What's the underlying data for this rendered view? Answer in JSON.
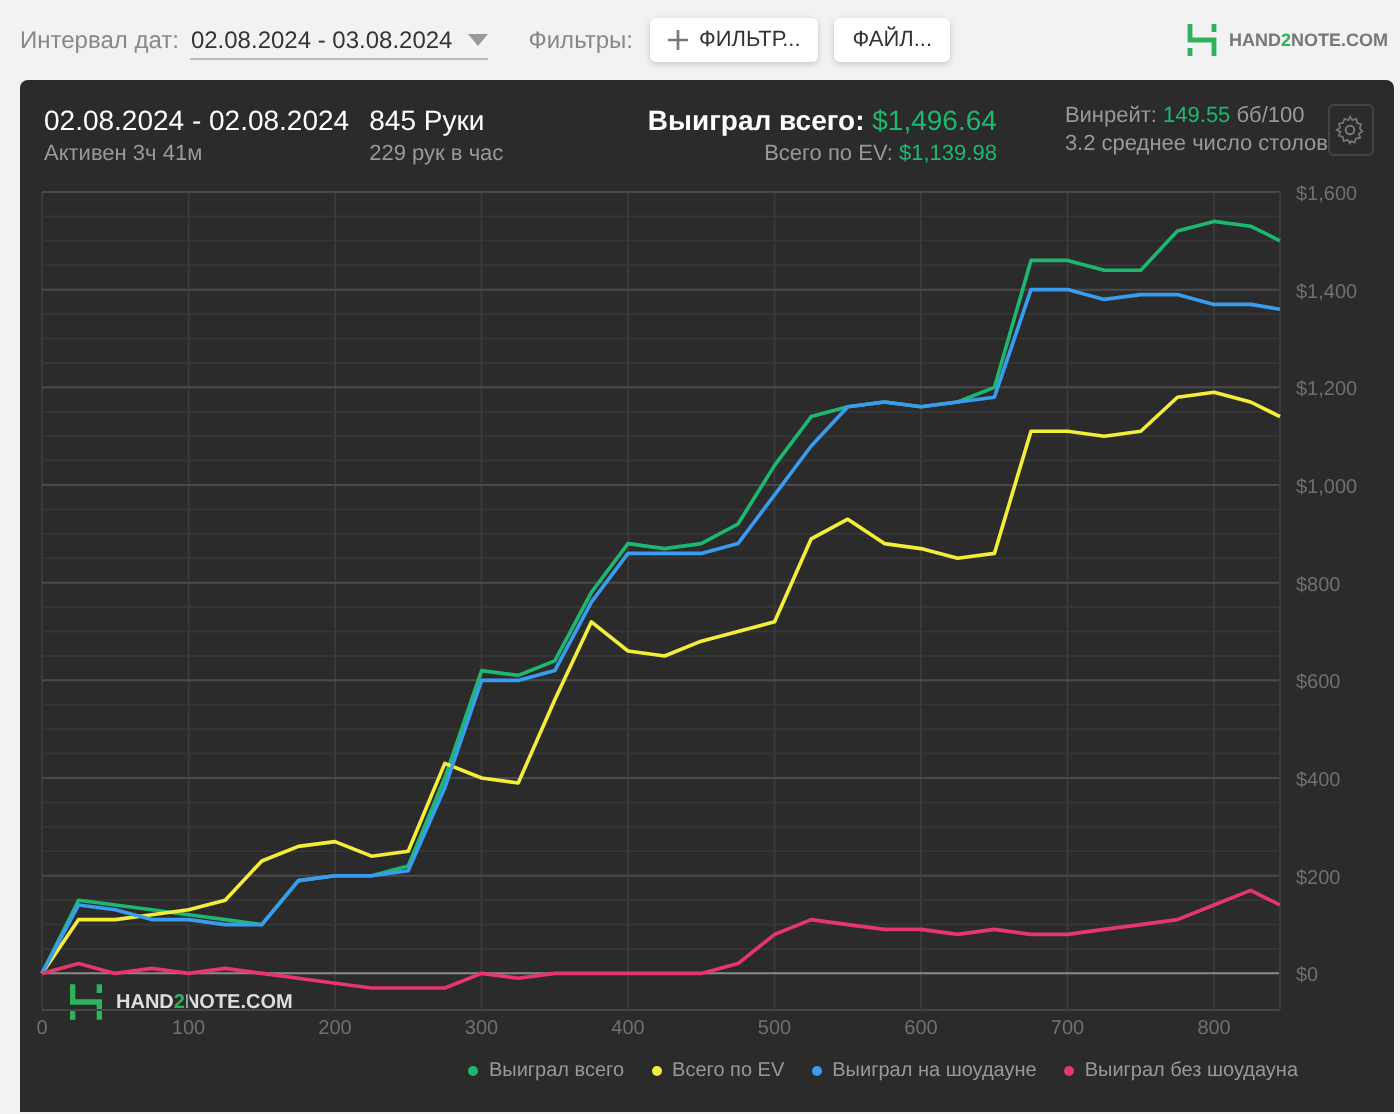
{
  "toolbar": {
    "date_label": "Интервал дат:",
    "date_value": "02.08.2024 - 03.08.2024",
    "filters_label": "Фильтры:",
    "filter_button": "ФИЛЬТР...",
    "file_button": "ФАЙЛ...",
    "logo": [
      "HAND",
      "2",
      "NOTE.COM"
    ]
  },
  "summary": {
    "date_range": "02.08.2024 - 02.08.2024",
    "active": "Активен 3ч 41м",
    "hands": "845 Руки",
    "hands_per_hour": "229 рук в час",
    "won_label": "Выиграл всего:",
    "won_value": "$1,496.64",
    "ev_label": "Всего по EV:",
    "ev_value": "$1,139.98",
    "winrate_label": "Винрейт:",
    "winrate_value": "149.55",
    "winrate_unit": "бб/100",
    "avg_tables": "3.2 среднее число столов"
  },
  "chart": {
    "watermark": [
      "HAND",
      "2",
      "NOTE.COM"
    ],
    "chart_data": {
      "type": "line",
      "x": [
        0,
        25,
        50,
        75,
        100,
        125,
        150,
        175,
        200,
        225,
        250,
        275,
        300,
        325,
        350,
        375,
        400,
        425,
        450,
        475,
        500,
        525,
        550,
        575,
        600,
        625,
        650,
        675,
        700,
        725,
        750,
        775,
        800,
        825,
        845
      ],
      "series": [
        {
          "name": "Выиграл всего",
          "color": "#1db870",
          "values": [
            0,
            150,
            140,
            130,
            120,
            110,
            100,
            190,
            200,
            200,
            220,
            400,
            620,
            610,
            640,
            780,
            880,
            870,
            880,
            920,
            1040,
            1140,
            1160,
            1170,
            1160,
            1170,
            1200,
            1460,
            1460,
            1440,
            1440,
            1520,
            1540,
            1530,
            1500
          ]
        },
        {
          "name": "Всего по EV",
          "color": "#f2ee3a",
          "values": [
            0,
            110,
            110,
            120,
            130,
            150,
            230,
            260,
            270,
            240,
            250,
            430,
            400,
            390,
            560,
            720,
            660,
            650,
            680,
            700,
            720,
            890,
            930,
            880,
            870,
            850,
            860,
            1110,
            1110,
            1100,
            1110,
            1180,
            1190,
            1170,
            1140
          ]
        },
        {
          "name": "Выиграл на шоудауне",
          "color": "#3a9cf0",
          "values": [
            0,
            140,
            130,
            110,
            110,
            100,
            100,
            190,
            200,
            200,
            210,
            380,
            600,
            600,
            620,
            760,
            860,
            860,
            860,
            880,
            980,
            1080,
            1160,
            1170,
            1160,
            1170,
            1180,
            1400,
            1400,
            1380,
            1390,
            1390,
            1370,
            1370,
            1360
          ]
        },
        {
          "name": "Выиграл без шоудауна",
          "color": "#e8356f",
          "values": [
            0,
            20,
            0,
            10,
            0,
            10,
            0,
            -10,
            -20,
            -30,
            -30,
            -30,
            0,
            -10,
            0,
            0,
            0,
            0,
            0,
            20,
            80,
            110,
            100,
            90,
            90,
            80,
            90,
            80,
            80,
            90,
            100,
            110,
            140,
            170,
            140
          ]
        }
      ],
      "grid": true,
      "xlim": [
        0,
        845
      ],
      "ylim": [
        -75,
        1600
      ],
      "xticks": [
        0,
        100,
        200,
        300,
        400,
        500,
        600,
        700,
        800
      ],
      "yticks": [
        {
          "value": 0,
          "label": "$0"
        },
        {
          "value": 200,
          "label": "$200"
        },
        {
          "value": 400,
          "label": "$400"
        },
        {
          "value": 600,
          "label": "$600"
        },
        {
          "value": 800,
          "label": "$800"
        },
        {
          "value": 1000,
          "label": "$1,000"
        },
        {
          "value": 1200,
          "label": "$1,200"
        },
        {
          "value": 1400,
          "label": "$1,400"
        },
        {
          "value": 1600,
          "label": "$1,600"
        }
      ]
    }
  }
}
